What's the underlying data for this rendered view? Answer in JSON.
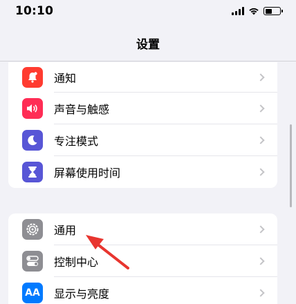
{
  "status": {
    "time": "10:10"
  },
  "nav": {
    "title": "设置"
  },
  "groups": [
    {
      "items": [
        {
          "label": "通知",
          "icon": "bell-icon",
          "color": "#ff3b30"
        },
        {
          "label": "声音与触感",
          "icon": "speaker-icon",
          "color": "#ff2d55"
        },
        {
          "label": "专注模式",
          "icon": "moon-icon",
          "color": "#5856d6"
        },
        {
          "label": "屏幕使用时间",
          "icon": "hourglass-icon",
          "color": "#5856d6"
        }
      ]
    },
    {
      "items": [
        {
          "label": "通用",
          "icon": "gear-icon",
          "color": "#8e8e93"
        },
        {
          "label": "控制中心",
          "icon": "toggles-icon",
          "color": "#8e8e93"
        },
        {
          "label": "显示与亮度",
          "icon": "display-icon",
          "color": "#007aff",
          "glyph": "AA"
        }
      ]
    }
  ],
  "annotation": {
    "arrow_color": "#e8352f",
    "target": "通用"
  }
}
